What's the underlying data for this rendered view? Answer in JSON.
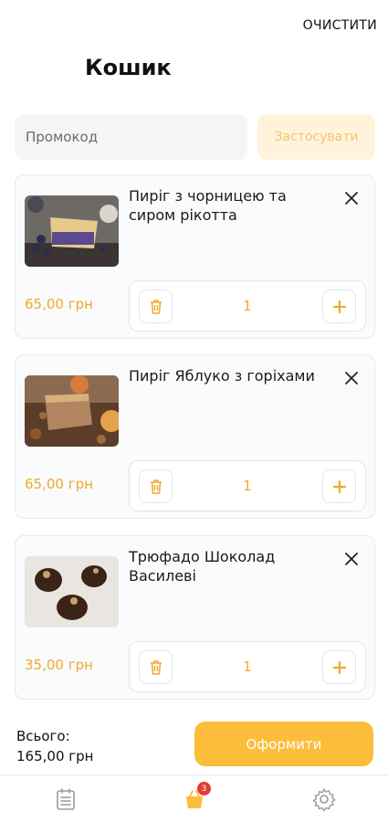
{
  "header": {
    "clear_label": "ОЧИСТИТИ",
    "title": "Кошик"
  },
  "promo": {
    "placeholder": "Промокод",
    "apply_label": "Застосувати"
  },
  "items": [
    {
      "name": "Пиріг з чорницею та сиром рікотта",
      "price": "65,00 грн",
      "quantity": "1"
    },
    {
      "name": "Пиріг Яблуко з горіхами",
      "price": "65,00 грн",
      "quantity": "1"
    },
    {
      "name": "Трюфадо Шоколад Василеві",
      "price": "35,00 грн",
      "quantity": "1"
    }
  ],
  "summary": {
    "total_label": "Всього:",
    "total_value": "165,00 грн",
    "checkout_label": "Оформити"
  },
  "nav": {
    "cart_badge": "3",
    "tabs": [
      "menu-icon",
      "cart-icon",
      "settings-icon"
    ]
  },
  "colors": {
    "accent": "#fbbd3a",
    "price": "#f0a92b",
    "apply_bg": "#fff3dc",
    "badge": "#e53935"
  }
}
